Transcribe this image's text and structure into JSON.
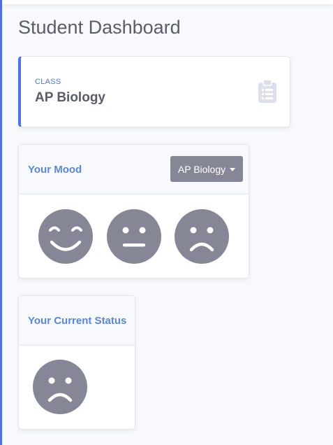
{
  "page": {
    "title": "Student Dashboard"
  },
  "class_card": {
    "label": "CLASS",
    "value": "AP Biology",
    "icon": "clipboard-list-icon"
  },
  "mood_card": {
    "title": "Your Mood",
    "dropdown": {
      "selected": "AP Biology"
    },
    "faces": [
      {
        "name": "happy-face-icon"
      },
      {
        "name": "neutral-face-icon"
      },
      {
        "name": "sad-face-icon"
      }
    ]
  },
  "status_card": {
    "title": "Your Current Status",
    "face": "sad-face-icon"
  },
  "colors": {
    "primary": "#4e73df",
    "header_text": "#5a87d3",
    "icon_gray": "#858796",
    "text_dark": "#5a5c69",
    "background": "#f8f9fc"
  }
}
